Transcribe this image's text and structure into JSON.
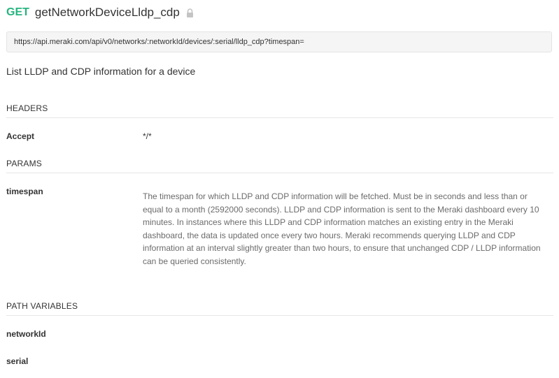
{
  "request": {
    "method": "GET",
    "name": "getNetworkDeviceLldp_cdp",
    "url": "https://api.meraki.com/api/v0/networks/:networkId/devices/:serial/lldp_cdp?timespan=",
    "description": "List LLDP and CDP information for a device"
  },
  "headers": {
    "title": "HEADERS",
    "items": [
      {
        "key": "Accept",
        "value": "*/*"
      }
    ]
  },
  "params": {
    "title": "PARAMS",
    "items": [
      {
        "key": "timespan",
        "description": "The timespan for which LLDP and CDP information will be fetched. Must be in seconds and less than or equal to a month (2592000 seconds). LLDP and CDP information is sent to the Meraki dashboard every 10 minutes. In instances where this LLDP and CDP information matches an existing entry in the Meraki dashboard, the data is updated once every two hours. Meraki recommends querying LLDP and CDP information at an interval slightly greater than two hours, to ensure that unchanged CDP / LLDP information can be queried consistently."
      }
    ]
  },
  "path_variables": {
    "title": "PATH VARIABLES",
    "items": [
      {
        "key": "networkId"
      },
      {
        "key": "serial"
      }
    ]
  },
  "colors": {
    "method_get": "#26b47f",
    "url_box_bg": "#f5f5f5",
    "divider": "#e6e6e6"
  },
  "icons": {
    "lock": "lock-icon"
  }
}
